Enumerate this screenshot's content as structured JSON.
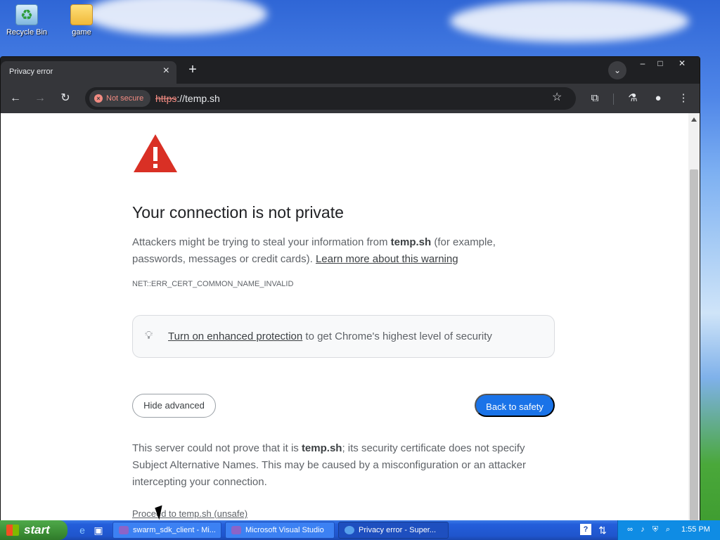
{
  "desktop": {
    "icons": [
      {
        "label": "Recycle Bin"
      },
      {
        "label": "game"
      }
    ]
  },
  "browser": {
    "tab": {
      "title": "Privacy error",
      "close": "×"
    },
    "new_tab": "+",
    "window_controls": {
      "minimize": "–",
      "maximize": "□",
      "close": "✕"
    },
    "nav": {
      "back": "←",
      "forward": "→",
      "reload": "↻"
    },
    "security_chip": "Not secure",
    "url_scheme": "https",
    "url_rest": "://temp.sh",
    "icons": {
      "bookmark": "star-icon",
      "extensions": "puzzle-icon",
      "labs": "flask-icon",
      "profile": "profile-icon",
      "menu": "kebab-menu-icon"
    }
  },
  "page": {
    "heading": "Your connection is not private",
    "desc_before": "Attackers might be trying to steal your information from ",
    "desc_domain": "temp.sh",
    "desc_after": " (for example, passwords, messages or credit cards). ",
    "learn_more": "Learn more about this warning",
    "error_code": "NET::ERR_CERT_COMMON_NAME_INVALID",
    "protection_link": "Turn on enhanced protection",
    "protection_text": " to get Chrome's highest level of security",
    "hide_advanced": "Hide advanced",
    "back_to_safety": "Back to safety",
    "details_before": "This server could not prove that it is ",
    "details_domain": "temp.sh",
    "details_after": "; its security certificate does not specify Subject Alternative Names. This may be caused by a misconfiguration or an attacker intercepting your connection.",
    "proceed_link": "Proceed to temp.sh (unsafe)"
  },
  "taskbar": {
    "start": "start",
    "tasks": [
      {
        "label": "swarm_sdk_client - Mi..."
      },
      {
        "label": "Microsoft Visual Studio"
      },
      {
        "label": "Privacy error - Super..."
      }
    ],
    "lang": "?",
    "clock": "1:55 PM"
  },
  "colors": {
    "accent_blue": "#1a73e8",
    "warning_red": "#d93025",
    "not_secure": "#f28b82"
  }
}
